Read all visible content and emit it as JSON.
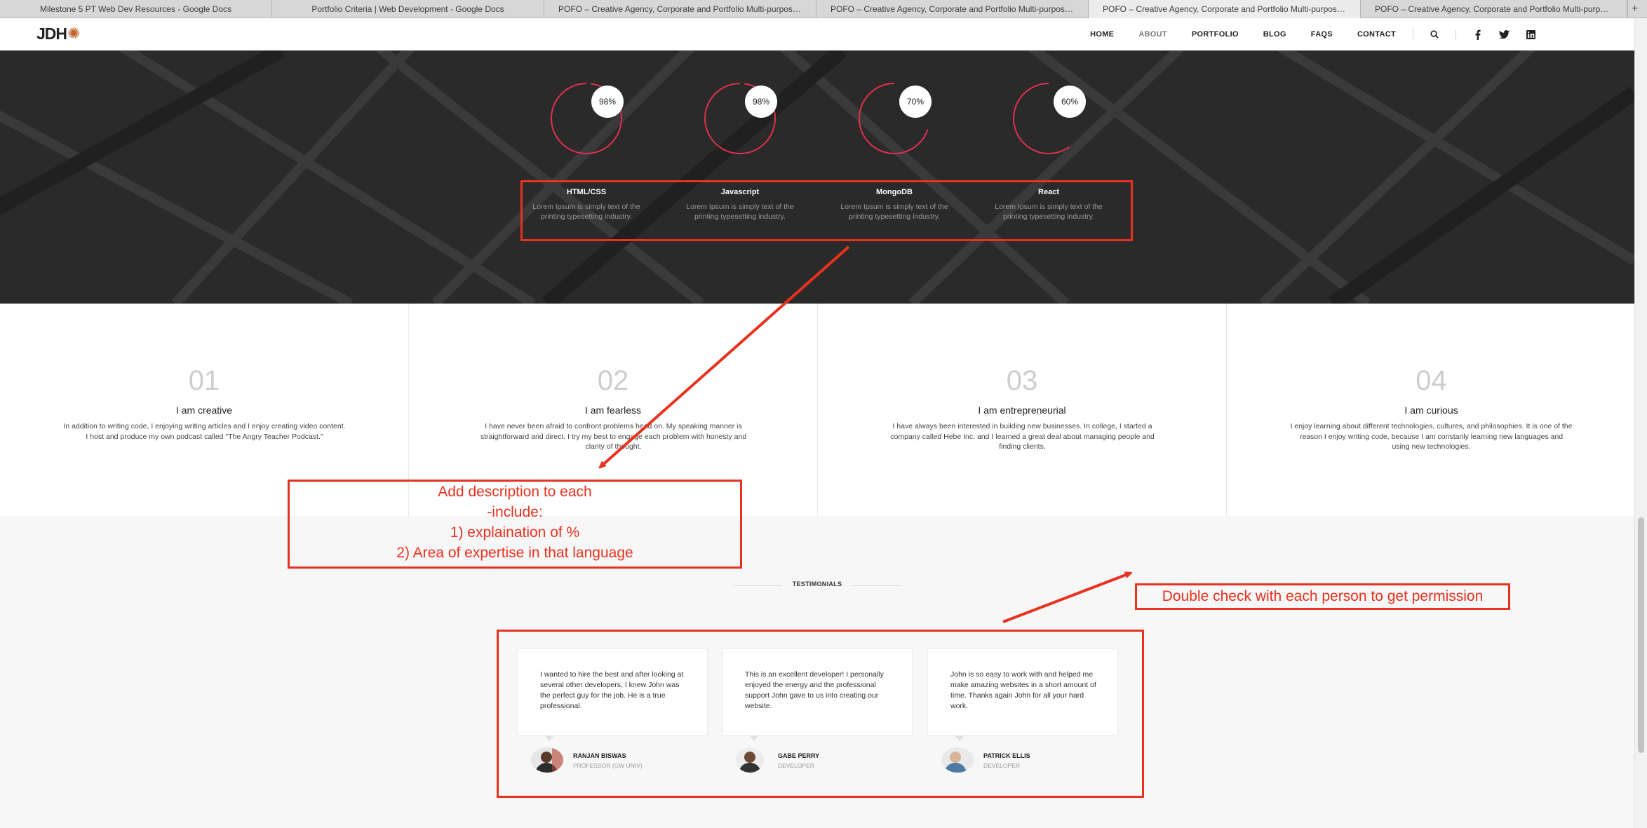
{
  "browser": {
    "tabs": [
      {
        "title": "Milestone 5 PT Web Dev Resources - Google Docs",
        "active": false
      },
      {
        "title": "Portfolio Criteria | Web Development - Google Docs",
        "active": false
      },
      {
        "title": "POFO – Creative Agency, Corporate and Portfolio Multi-purpose…",
        "active": false
      },
      {
        "title": "POFO – Creative Agency, Corporate and Portfolio Multi-purpose…",
        "active": false
      },
      {
        "title": "POFO – Creative Agency, Corporate and Portfolio Multi-purpose…",
        "active": true
      },
      {
        "title": "POFO – Creative Agency, Corporate and Portfolio Multi-purpose…",
        "active": false
      }
    ],
    "new_tab": "+"
  },
  "nav": {
    "logo_text": "JDH",
    "items": [
      "HOME",
      "ABOUT",
      "PORTFOLIO",
      "BLOG",
      "FAQS",
      "CONTACT"
    ],
    "current": "ABOUT",
    "icons": [
      "search-icon",
      "facebook-icon",
      "twitter-icon",
      "linkedin-icon"
    ]
  },
  "skills": [
    {
      "name": "HTML/CSS",
      "percent_label": "98%",
      "percent": 98,
      "desc": "Lorem Ipsum is simply text of the printing typesetting industry."
    },
    {
      "name": "Javascript",
      "percent_label": "98%",
      "percent": 98,
      "desc": "Lorem Ipsum is simply text of the printing typesetting industry."
    },
    {
      "name": "MongoDB",
      "percent_label": "70%",
      "percent": 70,
      "desc": "Lorem Ipsum is simply text of the printing typesetting industry."
    },
    {
      "name": "React",
      "percent_label": "60%",
      "percent": 60,
      "desc": "Lorem Ipsum is simply text of the printing typesetting industry."
    }
  ],
  "features": [
    {
      "num": "01",
      "title": "I am creative",
      "text": "In addition to writing code, I enjoying writing articles and I enjoy creating video content. I host and produce my own podcast called \"The Angry Teacher Podcast.\""
    },
    {
      "num": "02",
      "title": "I am fearless",
      "text": "I have never been afraid to confront problems head on. My speaking manner is straightforward and direct. I try my best to engage each problem with honesty and clarity of thought."
    },
    {
      "num": "03",
      "title": "I am entrepreneurial",
      "text": "I have always been interested in building new businesses. In college, I started a company called Hebe Inc. and I learned a great deal about managing people and finding clients."
    },
    {
      "num": "04",
      "title": "I am curious",
      "text": "I enjoy learning about different technologies, cultures, and philosophies. It is one of the reason I enjoy writing code, because I am constanly learning new languages and using new technologies."
    }
  ],
  "testimonials": {
    "heading": "TESTIMONIALS",
    "items": [
      {
        "quote": "I wanted to hire the best and after looking at several other developers, I knew John was the perfect guy for the job. He is a true professional.",
        "name": "RANJAN BISWAS",
        "role": "PROFESSOR (GW UNIV)"
      },
      {
        "quote": "This is an excellent developer! I personally enjoyed the energy and the professional support John gave to us into creating our website.",
        "name": "GABE PERRY",
        "role": "DEVELOPER"
      },
      {
        "quote": "John is so easy to work with and helped me make amazing websites in a short amount of time. Thanks again John for all your hard work.",
        "name": "PATRICK ELLIS",
        "role": "DEVELOPER"
      }
    ]
  },
  "annotations": {
    "note1": [
      "Add description to each",
      "-include:",
      "1) explaination of %",
      "2) Area of expertise in that language"
    ],
    "note2": "Double check with each person to get permission",
    "color": "#e8321f"
  },
  "colors": {
    "accent_ring": "#e0304e",
    "dark_bg": "#2a2a2a",
    "light_bg": "#f7f7f7"
  }
}
